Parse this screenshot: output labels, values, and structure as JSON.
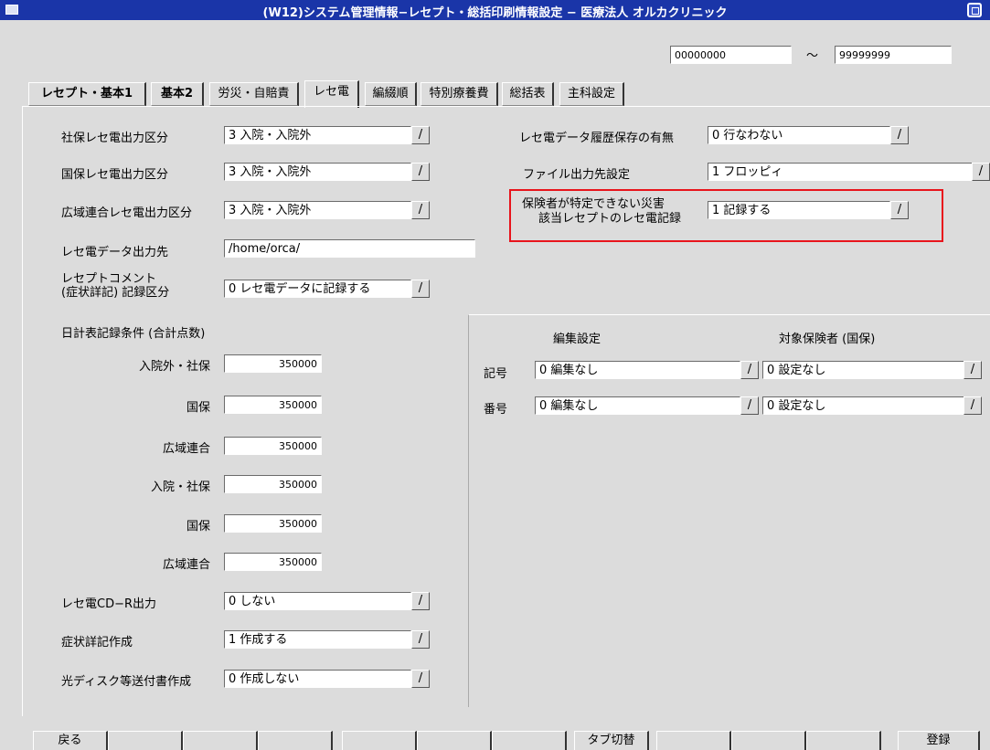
{
  "window": {
    "title": "(W12)システム管理情報−レセプト・総括印刷情報設定 − 医療法人 オルカクリニック"
  },
  "range": {
    "from": "00000000",
    "sep": "〜",
    "to": "99999999"
  },
  "tabs": [
    "レセプト・基本1",
    "基本2",
    "労災・自賠責",
    "レセ電",
    "編綴順",
    "特別療養費",
    "総括表",
    "主科設定"
  ],
  "left": {
    "shaho_label": "社保レセ電出力区分",
    "shaho_value": "3 入院・入院外",
    "kokuho_label": "国保レセ電出力区分",
    "kokuho_value": "3 入院・入院外",
    "kouiki_label": "広域連合レセ電出力区分",
    "kouiki_value": "3 入院・入院外",
    "output_dest_label": "レセ電データ出力先",
    "output_dest_value": "/home/orca/",
    "comment_label_1": "レセプトコメント",
    "comment_label_2": "(症状詳記) 記録区分",
    "comment_value": "0 レセ電データに記録する",
    "daily_header": "日計表記録条件 (合計点数)",
    "daily": [
      {
        "label": "入院外・社保",
        "value": "350000"
      },
      {
        "label": "国保",
        "value": "350000"
      },
      {
        "label": "広域連合",
        "value": "350000"
      },
      {
        "label": "入院・社保",
        "value": "350000"
      },
      {
        "label": "国保",
        "value": "350000"
      },
      {
        "label": "広域連合",
        "value": "350000"
      }
    ],
    "cdr_label": "レセ電CD−R出力",
    "cdr_value": "0 しない",
    "symptom_label": "症状詳記作成",
    "symptom_value": "1 作成する",
    "disc_label": "光ディスク等送付書作成",
    "disc_value": "0 作成しない"
  },
  "right": {
    "history_label": "レセ電データ履歴保存の有無",
    "history_value": "0 行なわない",
    "file_dest_label": "ファイル出力先設定",
    "file_dest_value": "1 フロッピィ",
    "disaster_label_1": "保険者が特定できない災害",
    "disaster_label_2": "該当レセプトのレセ電記録",
    "disaster_value": "1 記録する",
    "edit_header": "編集設定",
    "target_header": "対象保険者 (国保)",
    "kigou_label": "記号",
    "kigou_edit": "0 編集なし",
    "kigou_target": "0 設定なし",
    "bangou_label": "番号",
    "bangou_edit": "0 編集なし",
    "bangou_target": "0 設定なし"
  },
  "fkeys": [
    "戻る",
    "",
    "",
    "",
    "",
    "",
    "",
    "タブ切替",
    "",
    "",
    "",
    "登録"
  ],
  "dropdown_glyph": "/",
  "colors": {
    "titlebar": "#1a35a8",
    "highlight_box": "#e8141c",
    "background": "#dcdcdc"
  }
}
